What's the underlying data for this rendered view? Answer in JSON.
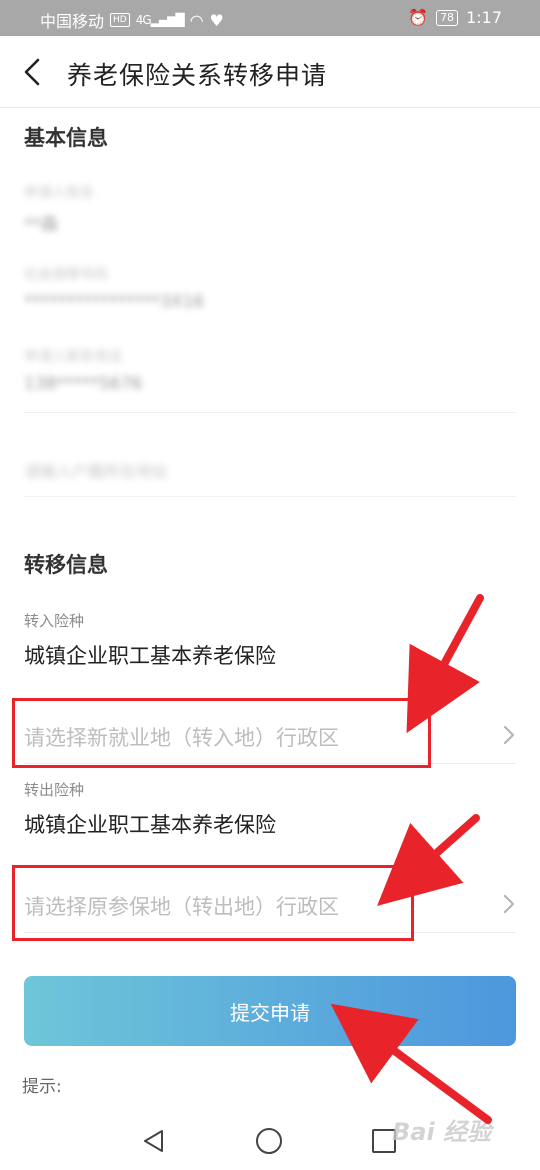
{
  "status_bar": {
    "carrier": "中国移动",
    "hd": "HD",
    "network": "4G",
    "battery": "78",
    "time": "1:17"
  },
  "header": {
    "title": "养老保险关系转移申请"
  },
  "basic_info": {
    "title": "基本信息",
    "fields": [
      {
        "label": "申请人姓名",
        "value": "**森"
      },
      {
        "label": "社会保障号码",
        "value": "****************3X16"
      },
      {
        "label": "申请人联系电话",
        "value": "138*****5676"
      }
    ],
    "extra_placeholder": "请输入户籍所在地址"
  },
  "transfer_info": {
    "title": "转移信息",
    "in_label": "转入险种",
    "in_value": "城镇企业职工基本养老保险",
    "in_region_placeholder": "请选择新就业地（转入地）行政区",
    "out_label": "转出险种",
    "out_value": "城镇企业职工基本养老保险",
    "out_region_placeholder": "请选择原参保地（转出地）行政区"
  },
  "submit_label": "提交申请",
  "tip_label": "提示:",
  "watermark": "Bai 经验",
  "colors": {
    "annotation_red": "#e8232a",
    "button_gradient_start": "#6ec6d9",
    "button_gradient_end": "#4d97dd"
  }
}
